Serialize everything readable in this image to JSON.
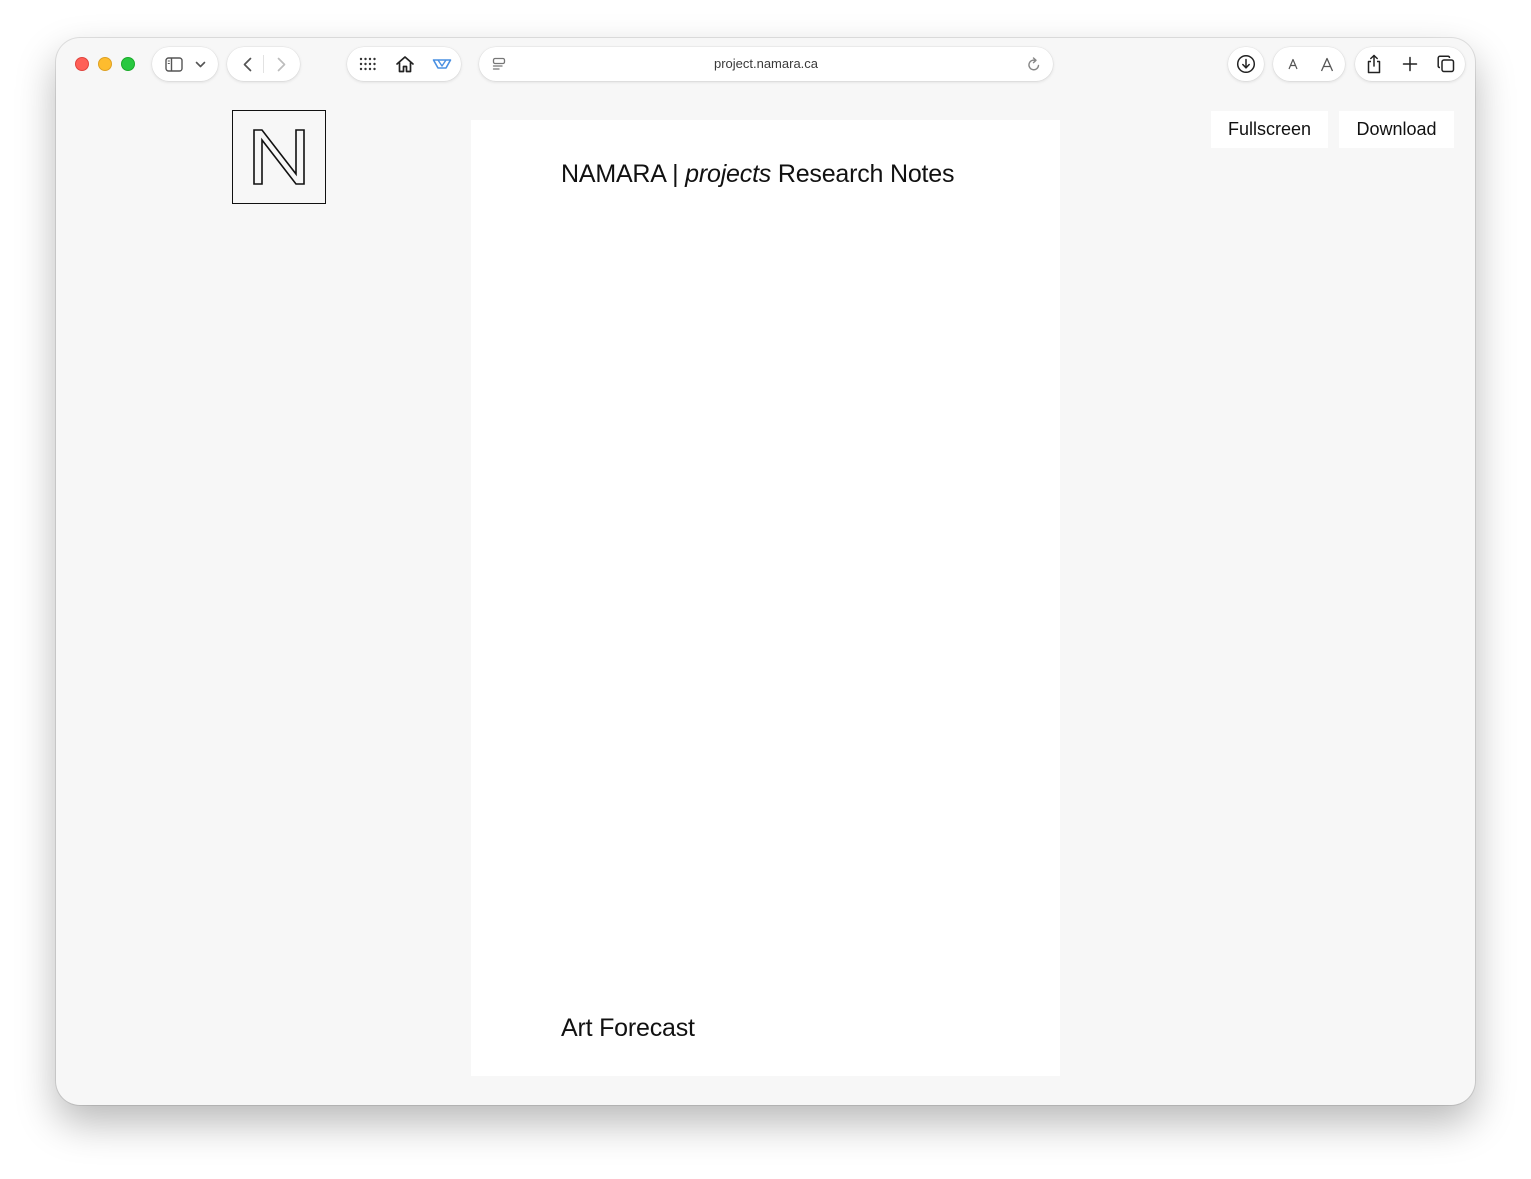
{
  "browser": {
    "url": "project.namara.ca"
  },
  "page": {
    "logo_letter": "N",
    "title_prefix": "NAMARA | ",
    "title_italic": "projects",
    "title_suffix": " Research Notes",
    "footer_title": "Art Forecast",
    "fullscreen_label": "Fullscreen",
    "download_label": "Download"
  },
  "icons": {
    "sidebar": "sidebar-icon",
    "chevron": "chevron-down-icon",
    "back": "chevron-left-icon",
    "forward": "chevron-right-icon",
    "grid": "grid-icon",
    "home": "home-icon",
    "extension": "extension-icon",
    "reader": "page-menu-icon",
    "reload": "reload-icon",
    "downloads": "download-arrow-icon",
    "text_smaller": "text-smaller-icon",
    "text_larger": "text-larger-icon",
    "share": "share-icon",
    "new_tab": "plus-icon",
    "tabs": "tab-overview-icon"
  },
  "colors": {
    "close": "#ff5f57",
    "minimize": "#febc2e",
    "zoom": "#28c840",
    "accent": "#4a90e2"
  }
}
